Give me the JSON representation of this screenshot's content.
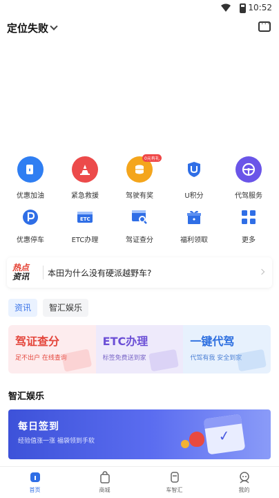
{
  "status_bar": {
    "time": "10:52"
  },
  "header": {
    "location": "定位失败"
  },
  "grid": {
    "row1": [
      {
        "label": "优惠加油",
        "icon": "fuel-icon",
        "color": "#2f7ef2"
      },
      {
        "label": "紧急救援",
        "icon": "rescue-cone-icon",
        "color": "#ec4a4a"
      },
      {
        "label": "驾驶有奖",
        "icon": "coins-icon",
        "color": "#f4a51c",
        "badge": "0元有礼"
      },
      {
        "label": "U积分",
        "icon": "u-points-icon",
        "color": "#2f6ee6"
      },
      {
        "label": "代驾服务",
        "icon": "steering-wheel-icon",
        "color": "#6a55e8"
      }
    ],
    "row2": [
      {
        "label": "优惠停车",
        "icon": "parking-icon",
        "color": "#2f6ee6"
      },
      {
        "label": "ETC办理",
        "icon": "etc-card-icon",
        "color": "#2f6ee6"
      },
      {
        "label": "驾证查分",
        "icon": "license-search-icon",
        "color": "#2f6ee6"
      },
      {
        "label": "福利领取",
        "icon": "gift-icon",
        "color": "#2f6ee6"
      },
      {
        "label": "更多",
        "icon": "more-grid-icon",
        "color": "#2f6ee6"
      }
    ]
  },
  "hot_news": {
    "logo_top": "热点",
    "logo_bottom": "资讯",
    "title": "本田为什么没有硬派越野车?"
  },
  "tabs": [
    {
      "label": "资讯",
      "active": true
    },
    {
      "label": "智汇娱乐",
      "active": false
    }
  ],
  "cards": [
    {
      "title": "驾证查分",
      "subtitle": "足不出户 在线查询"
    },
    {
      "title": "ETC办理",
      "subtitle": "标签免费送到家"
    },
    {
      "title": "一键代驾",
      "subtitle": "代驾有我 安全到家"
    }
  ],
  "section_title": "智汇娱乐",
  "banner": {
    "title": "每日签到",
    "subtitle": "经验值涨一涨 福袋领到手软"
  },
  "bottom_nav": [
    {
      "label": "首页",
      "active": true,
      "icon": "home-icon"
    },
    {
      "label": "商城",
      "active": false,
      "icon": "shopping-bag-icon"
    },
    {
      "label": "车智汇",
      "active": false,
      "icon": "car-hub-icon"
    },
    {
      "label": "我的",
      "active": false,
      "icon": "profile-icon"
    }
  ],
  "colors": {
    "accent": "#2f6ee6"
  }
}
